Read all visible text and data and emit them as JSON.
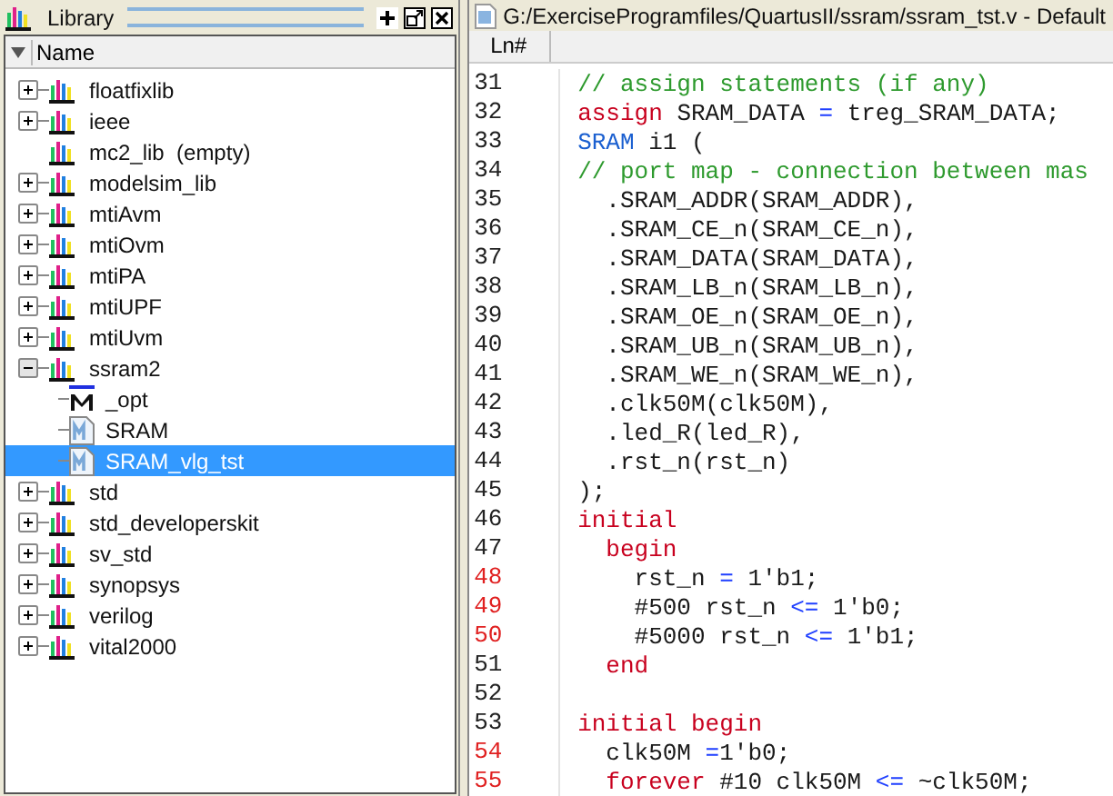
{
  "library_panel": {
    "title": "Library",
    "column_header": "Name",
    "items": [
      {
        "label": "floatfixlib",
        "kind": "library",
        "expanded": false,
        "selected": false
      },
      {
        "label": "ieee",
        "kind": "library",
        "expanded": false,
        "selected": false
      },
      {
        "label": "mc2_lib  (empty)",
        "kind": "library",
        "selected": false
      },
      {
        "label": "modelsim_lib",
        "kind": "library",
        "expanded": false,
        "selected": false
      },
      {
        "label": "mtiAvm",
        "kind": "library",
        "expanded": false,
        "selected": false
      },
      {
        "label": "mtiOvm",
        "kind": "library",
        "expanded": false,
        "selected": false
      },
      {
        "label": "mtiPA",
        "kind": "library",
        "expanded": false,
        "selected": false
      },
      {
        "label": "mtiUPF",
        "kind": "library",
        "expanded": false,
        "selected": false
      },
      {
        "label": "mtiUvm",
        "kind": "library",
        "expanded": false,
        "selected": false
      },
      {
        "label": "ssram2",
        "kind": "library",
        "expanded": true,
        "selected": false,
        "children": [
          {
            "label": "_opt",
            "kind": "optimized",
            "selected": false
          },
          {
            "label": "SRAM",
            "kind": "module",
            "selected": false
          },
          {
            "label": "SRAM_vlg_tst",
            "kind": "module",
            "selected": true
          }
        ]
      },
      {
        "label": "std",
        "kind": "library",
        "expanded": false,
        "selected": false
      },
      {
        "label": "std_developerskit",
        "kind": "library",
        "expanded": false,
        "selected": false
      },
      {
        "label": "sv_std",
        "kind": "library",
        "expanded": false,
        "selected": false
      },
      {
        "label": "synopsys",
        "kind": "library",
        "expanded": false,
        "selected": false
      },
      {
        "label": "verilog",
        "kind": "library",
        "expanded": false,
        "selected": false
      },
      {
        "label": "vital2000",
        "kind": "library",
        "expanded": false,
        "selected": false
      }
    ]
  },
  "editor": {
    "title": "G:/ExerciseProgramfiles/QuartusII/ssram/ssram_tst.v - Default",
    "line_header": "Ln#",
    "lines": [
      {
        "number": "31",
        "marked": false,
        "tokens": [
          {
            "kind": "comment",
            "text": "// assign statements (if any)"
          }
        ]
      },
      {
        "number": "32",
        "marked": false,
        "tokens": [
          {
            "kind": "keyword",
            "text": "assign"
          },
          {
            "kind": "plain",
            "text": " SRAM_DATA "
          },
          {
            "kind": "operator",
            "text": "="
          },
          {
            "kind": "plain",
            "text": " treg_SRAM_DATA;"
          }
        ]
      },
      {
        "number": "33",
        "marked": false,
        "tokens": [
          {
            "kind": "type",
            "text": "SRAM"
          },
          {
            "kind": "plain",
            "text": " i1 ("
          }
        ]
      },
      {
        "number": "34",
        "marked": false,
        "tokens": [
          {
            "kind": "comment",
            "text": "// port map - connection between mas"
          }
        ]
      },
      {
        "number": "35",
        "marked": false,
        "tokens": [
          {
            "kind": "plain",
            "text": "  .SRAM_ADDR(SRAM_ADDR),"
          }
        ]
      },
      {
        "number": "36",
        "marked": false,
        "tokens": [
          {
            "kind": "plain",
            "text": "  .SRAM_CE_n(SRAM_CE_n),"
          }
        ]
      },
      {
        "number": "37",
        "marked": false,
        "tokens": [
          {
            "kind": "plain",
            "text": "  .SRAM_DATA(SRAM_DATA),"
          }
        ]
      },
      {
        "number": "38",
        "marked": false,
        "tokens": [
          {
            "kind": "plain",
            "text": "  .SRAM_LB_n(SRAM_LB_n),"
          }
        ]
      },
      {
        "number": "39",
        "marked": false,
        "tokens": [
          {
            "kind": "plain",
            "text": "  .SRAM_OE_n(SRAM_OE_n),"
          }
        ]
      },
      {
        "number": "40",
        "marked": false,
        "tokens": [
          {
            "kind": "plain",
            "text": "  .SRAM_UB_n(SRAM_UB_n),"
          }
        ]
      },
      {
        "number": "41",
        "marked": false,
        "tokens": [
          {
            "kind": "plain",
            "text": "  .SRAM_WE_n(SRAM_WE_n),"
          }
        ]
      },
      {
        "number": "42",
        "marked": false,
        "tokens": [
          {
            "kind": "plain",
            "text": "  .clk50M(clk50M),"
          }
        ]
      },
      {
        "number": "43",
        "marked": false,
        "tokens": [
          {
            "kind": "plain",
            "text": "  .led_R(led_R),"
          }
        ]
      },
      {
        "number": "44",
        "marked": false,
        "tokens": [
          {
            "kind": "plain",
            "text": "  .rst_n(rst_n)"
          }
        ]
      },
      {
        "number": "45",
        "marked": false,
        "tokens": [
          {
            "kind": "plain",
            "text": ");"
          }
        ]
      },
      {
        "number": "46",
        "marked": false,
        "tokens": [
          {
            "kind": "keyword",
            "text": "initial"
          }
        ]
      },
      {
        "number": "47",
        "marked": false,
        "tokens": [
          {
            "kind": "keyword",
            "text": "  begin"
          }
        ]
      },
      {
        "number": "48",
        "marked": true,
        "tokens": [
          {
            "kind": "plain",
            "text": "    rst_n "
          },
          {
            "kind": "operator",
            "text": "="
          },
          {
            "kind": "plain",
            "text": " 1'b1;"
          }
        ]
      },
      {
        "number": "49",
        "marked": true,
        "tokens": [
          {
            "kind": "plain",
            "text": "    #500 rst_n "
          },
          {
            "kind": "operator",
            "text": "<="
          },
          {
            "kind": "plain",
            "text": " 1'b0;"
          }
        ]
      },
      {
        "number": "50",
        "marked": true,
        "tokens": [
          {
            "kind": "plain",
            "text": "    #5000 rst_n "
          },
          {
            "kind": "operator",
            "text": "<="
          },
          {
            "kind": "plain",
            "text": " 1'b1;"
          }
        ]
      },
      {
        "number": "51",
        "marked": false,
        "tokens": [
          {
            "kind": "keyword",
            "text": "  end"
          }
        ]
      },
      {
        "number": "52",
        "marked": false
      },
      {
        "number": "53",
        "marked": false,
        "tokens": [
          {
            "kind": "keyword",
            "text": "initial begin"
          }
        ]
      },
      {
        "number": "54",
        "marked": true,
        "tokens": [
          {
            "kind": "plain",
            "text": "  clk50M "
          },
          {
            "kind": "operator",
            "text": "="
          },
          {
            "kind": "plain",
            "text": "1'b0;"
          }
        ]
      },
      {
        "number": "55",
        "marked": true,
        "tokens": [
          {
            "kind": "keyword",
            "text": "  forever"
          },
          {
            "kind": "plain",
            "text": " #10 clk50M "
          },
          {
            "kind": "operator",
            "text": "<="
          },
          {
            "kind": "plain",
            "text": " ~clk50M;"
          }
        ]
      }
    ]
  }
}
